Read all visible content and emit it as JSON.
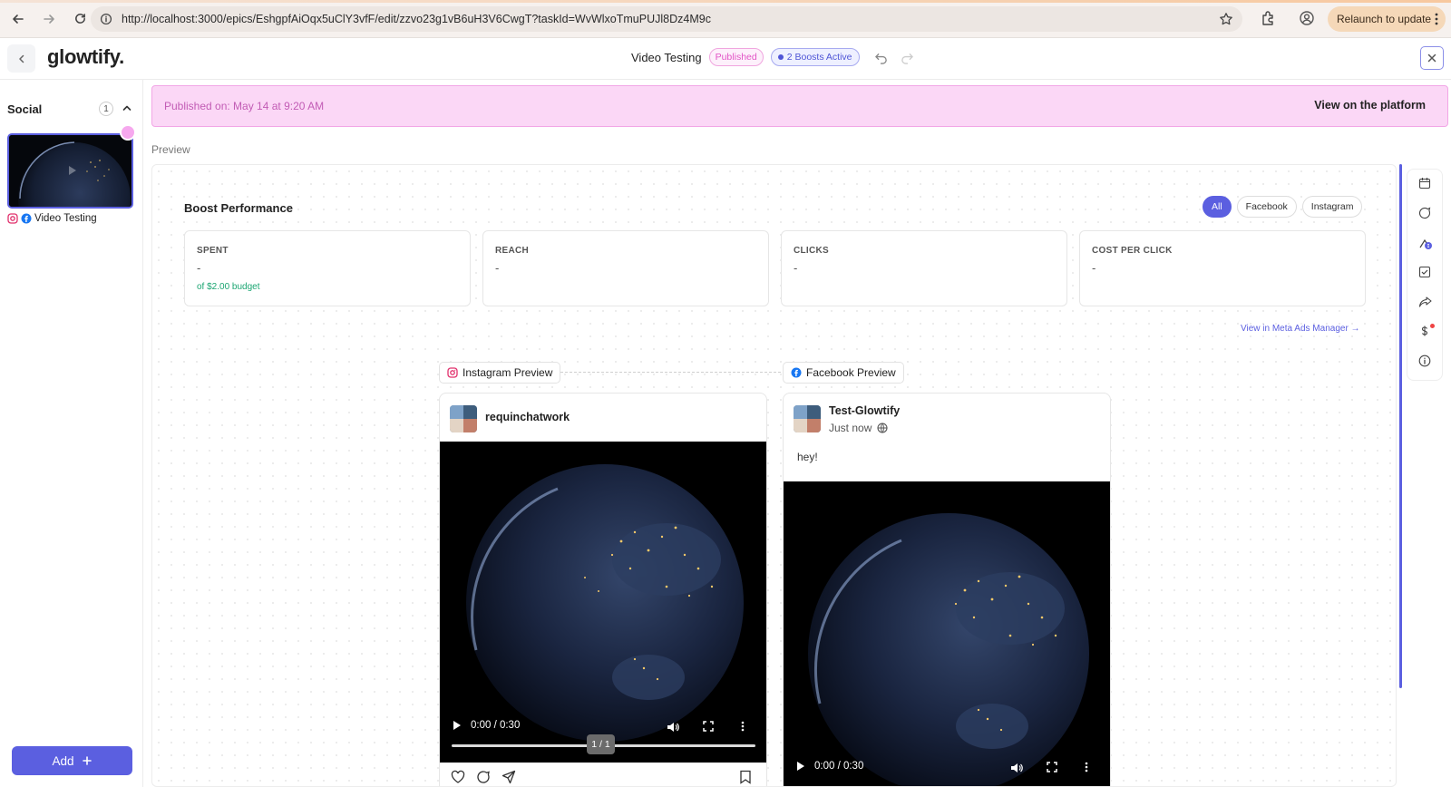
{
  "browser": {
    "url": "http://localhost:3000/epics/EshgpfAiOqx5uClY3vfF/edit/zzvo23g1vB6uH3V6CwgT?taskId=WvWlxoTmuPUJl8Dz4M9c",
    "relaunch_label": "Relaunch to update"
  },
  "header": {
    "logo": "glowtify.",
    "title": "Video Testing",
    "status_badge": "Published",
    "boost_badge": "2 Boosts Active"
  },
  "sidebar": {
    "section_title": "Social",
    "count": "1",
    "item_label": "Video Testing",
    "add_label": "Add"
  },
  "banner": {
    "text": "Published on: May 14 at 9:20 AM",
    "link": "View on the platform"
  },
  "preview_label": "Preview",
  "boost": {
    "title": "Boost Performance",
    "filters": [
      "All",
      "Facebook",
      "Instagram"
    ],
    "active_filter": "All",
    "stats": [
      {
        "label": "SPENT",
        "value": "-",
        "sub": "of $2.00 budget"
      },
      {
        "label": "REACH",
        "value": "-",
        "sub": ""
      },
      {
        "label": "CLICKS",
        "value": "-",
        "sub": ""
      },
      {
        "label": "COST PER CLICK",
        "value": "-",
        "sub": ""
      }
    ],
    "meta_link": "View in Meta Ads Manager →"
  },
  "instagram": {
    "tag": "Instagram Preview",
    "username": "requinchatwork",
    "time": "0:00 / 0:30",
    "pager": "1 / 1"
  },
  "facebook": {
    "tag": "Facebook Preview",
    "page_name": "Test-Glowtify",
    "posted": "Just now",
    "caption": "hey!",
    "time": "0:00 / 0:30"
  },
  "colors": {
    "accent": "#5b5fe0",
    "published": "#e254c6",
    "banner_bg": "#fbd7f6",
    "budget_green": "#1aa571"
  }
}
